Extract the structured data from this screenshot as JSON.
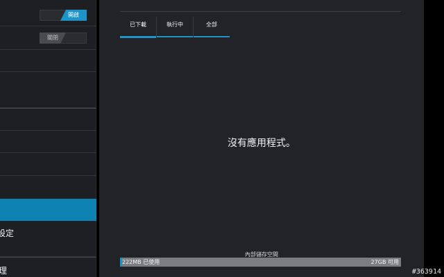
{
  "settings": {
    "toggle1": {
      "label": "開啟",
      "state": "on"
    },
    "toggle2": {
      "label": "關閉",
      "state": "off"
    },
    "partial_item1": "設定",
    "partial_item2": "理"
  },
  "apps": {
    "tabs": [
      "已下載",
      "執行中",
      "全部"
    ],
    "selected_tab": "已下載",
    "empty_message": "沒有應用程式。",
    "storage": {
      "title": "內部儲存空間",
      "used": "222MB 已使用",
      "free": "27GB 可用",
      "used_fraction": 0.008
    }
  },
  "watermark": "#363914",
  "colors": {
    "accent": "#1d93c7",
    "pane": "#222327",
    "sidebar": "#1e1f22"
  }
}
